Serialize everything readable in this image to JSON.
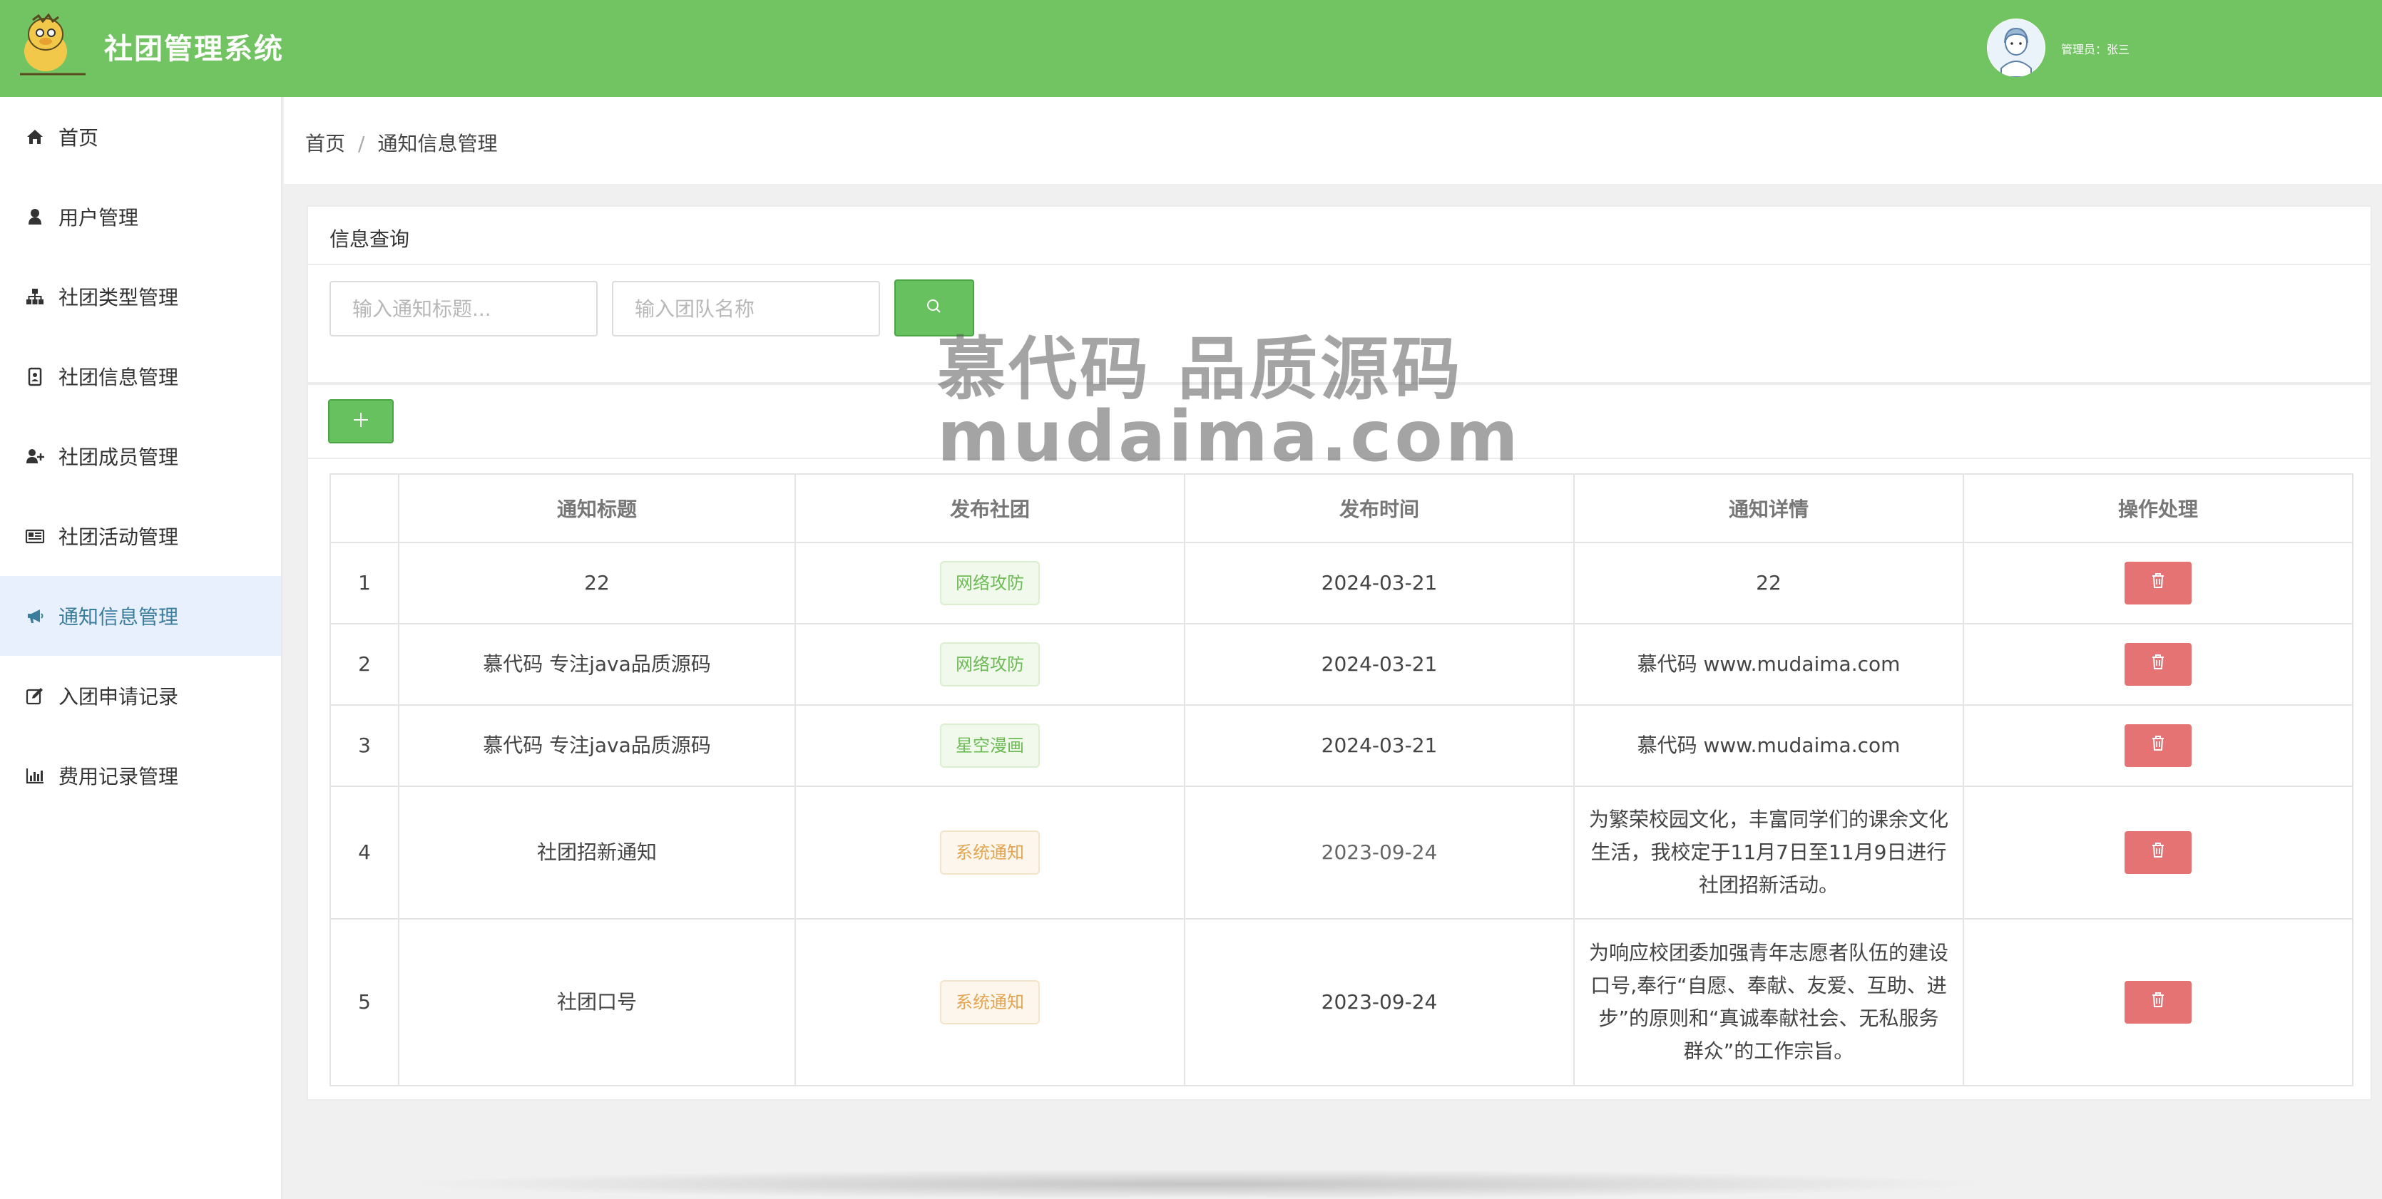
{
  "header": {
    "app_title": "社团管理系统",
    "admin_label": "管理员：张三"
  },
  "sidebar": {
    "items": [
      {
        "label": "首页",
        "icon": "home-icon"
      },
      {
        "label": "用户管理",
        "icon": "user-icon"
      },
      {
        "label": "社团类型管理",
        "icon": "sitemap-icon"
      },
      {
        "label": "社团信息管理",
        "icon": "id-badge-icon"
      },
      {
        "label": "社团成员管理",
        "icon": "user-plus-icon"
      },
      {
        "label": "社团活动管理",
        "icon": "newspaper-icon"
      },
      {
        "label": "通知信息管理",
        "icon": "bullhorn-icon",
        "active": true
      },
      {
        "label": "入团申请记录",
        "icon": "edit-icon"
      },
      {
        "label": "费用记录管理",
        "icon": "bar-chart-icon"
      }
    ]
  },
  "breadcrumb": {
    "home": "首页",
    "separator": "/",
    "current": "通知信息管理"
  },
  "query": {
    "title": "信息查询",
    "title_placeholder": "输入通知标题...",
    "team_placeholder": "输入团队名称"
  },
  "table": {
    "headers": [
      "",
      "通知标题",
      "发布社团",
      "发布时间",
      "通知详情",
      "操作处理"
    ],
    "rows": [
      {
        "index": "1",
        "title": "22",
        "team": "网络攻防",
        "team_color": "green",
        "date": "2024-03-21",
        "detail": "22"
      },
      {
        "index": "2",
        "title": "慕代码 专注java品质源码",
        "team": "网络攻防",
        "team_color": "green",
        "date": "2024-03-21",
        "detail": "慕代码 www.mudaima.com"
      },
      {
        "index": "3",
        "title": "慕代码 专注java品质源码",
        "team": "星空漫画",
        "team_color": "green",
        "date": "2024-03-21",
        "detail": "慕代码 www.mudaima.com"
      },
      {
        "index": "4",
        "title": "社团招新通知",
        "team": "系统通知",
        "team_color": "orange",
        "date": "2023-09-24",
        "detail": "为繁荣校园文化，丰富同学们的课余文化生活，我校定于11月7日至11月9日进行社团招新活动。"
      },
      {
        "index": "5",
        "title": "社团口号",
        "team": "系统通知",
        "team_color": "orange",
        "date": "2023-09-24",
        "detail": "为响应校团委加强青年志愿者队伍的建设口号,奉行“自愿、奉献、友爱、互助、进步”的原则和“真诚奉献社会、无私服务群众”的工作宗旨。"
      }
    ]
  },
  "watermark": {
    "line1": "慕代码 品质源码",
    "line2": "mudaima.com"
  },
  "colors": {
    "header_bg": "#72c462",
    "primary_green": "#67c15e",
    "danger_red": "#e57373",
    "active_nav_bg": "#e8f0fe",
    "active_nav_text": "#3b7d9c"
  }
}
